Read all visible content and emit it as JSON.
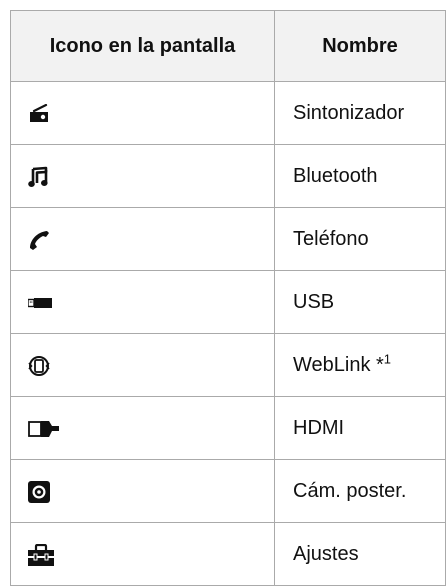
{
  "table": {
    "headers": {
      "icon": "Icono en la pantalla",
      "name": "Nombre"
    },
    "rows": [
      {
        "icon": "radio-tuner-icon",
        "name": "Sintonizador",
        "sup": ""
      },
      {
        "icon": "music-note-icon",
        "name": "Bluetooth",
        "sup": ""
      },
      {
        "icon": "phone-handset-icon",
        "name": "Teléfono",
        "sup": ""
      },
      {
        "icon": "usb-drive-icon",
        "name": "USB",
        "sup": ""
      },
      {
        "icon": "weblink-icon",
        "name": "WebLink *",
        "sup": "1"
      },
      {
        "icon": "hdmi-plug-icon",
        "name": "HDMI",
        "sup": ""
      },
      {
        "icon": "rear-camera-icon",
        "name": "Cám. poster.",
        "sup": ""
      },
      {
        "icon": "toolbox-icon",
        "name": "Ajustes",
        "sup": ""
      }
    ]
  },
  "colors": {
    "border": "#aaaaaa",
    "header_bg": "#f2f2f2",
    "icon": "#111111"
  }
}
